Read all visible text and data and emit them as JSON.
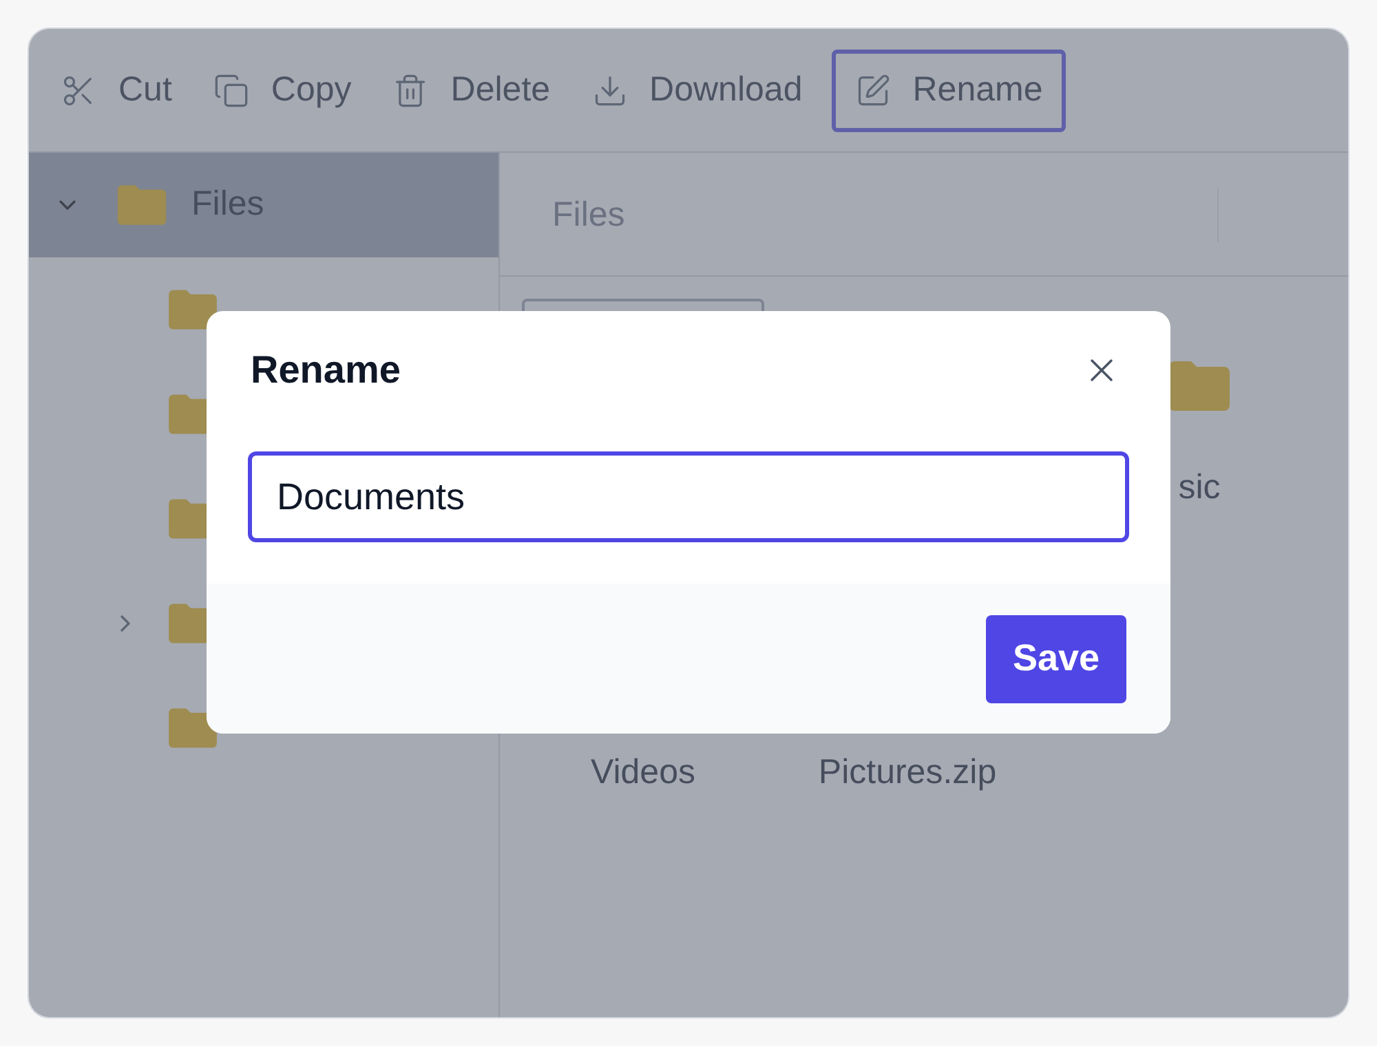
{
  "toolbar": [
    {
      "kind": "cut",
      "label": "Cut",
      "selected": false
    },
    {
      "kind": "copy",
      "label": "Copy",
      "selected": false
    },
    {
      "kind": "delete",
      "label": "Delete",
      "selected": false
    },
    {
      "kind": "download",
      "label": "Download",
      "selected": false
    },
    {
      "kind": "rename",
      "label": "Rename",
      "selected": true
    }
  ],
  "sidebar": {
    "root": {
      "label": "Files",
      "expanded": true,
      "selected": true,
      "children": [
        {
          "kind": "folder"
        },
        {
          "kind": "folder"
        },
        {
          "kind": "folder"
        },
        {
          "kind": "folder",
          "expanded": false
        },
        {
          "kind": "folder"
        }
      ]
    }
  },
  "breadcrumb": "Files",
  "tiles": [
    {
      "selected": true
    },
    {
      "kind": "folder",
      "label": "sic",
      "selected": false
    },
    {
      "label": "Videos",
      "selected": false
    },
    {
      "label": "Pictures.zip",
      "selected": false
    }
  ],
  "dialog": {
    "title": "Rename",
    "value": "Documents",
    "button": "Save"
  }
}
